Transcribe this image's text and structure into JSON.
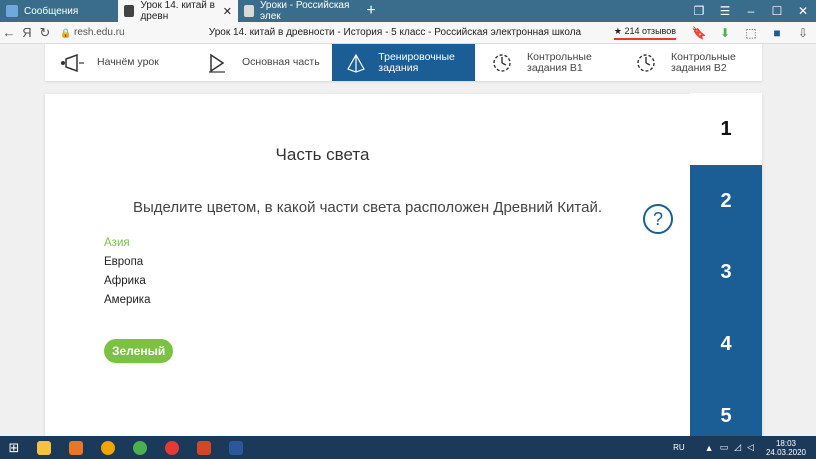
{
  "browser": {
    "tabs": [
      {
        "label": "Сообщения",
        "active": false
      },
      {
        "label": "Урок 14. китай в древн",
        "active": true
      },
      {
        "label": "Уроки - Российская элек",
        "active": false
      }
    ],
    "new_tab": "+",
    "url": "resh.edu.ru",
    "page_title": "Урок 14. китай в древности - История - 5 класс - Российская электронная школа",
    "reviews": "★ 214 отзывов",
    "nav_y": "Я"
  },
  "lesson_nav": [
    {
      "label": "Начнём урок",
      "icon": "speaker-icon"
    },
    {
      "label": "Основная часть",
      "icon": "play-icon"
    },
    {
      "label": "Тренировочные задания",
      "icon": "pyramid-icon"
    },
    {
      "label": "Контрольные задания В1",
      "icon": "timer-icon"
    },
    {
      "label": "Контрольные задания В2",
      "icon": "timer-icon"
    }
  ],
  "question": {
    "title": "Часть света",
    "text": "Выделите цветом, в какой части света расположен Древний Китай.",
    "help": "?",
    "options": [
      "Азия",
      "Европа",
      "Африка",
      "Америка"
    ],
    "selected_option": "Азия",
    "color_button": "Зеленый"
  },
  "steps": [
    "1",
    "2",
    "3",
    "4",
    "5"
  ],
  "current_step": "1",
  "taskbar": {
    "lang": "RU",
    "time": "18:03",
    "date": "24.03.2020"
  },
  "colors": {
    "accent_blue": "#1b5e96",
    "green": "#7cc242"
  }
}
